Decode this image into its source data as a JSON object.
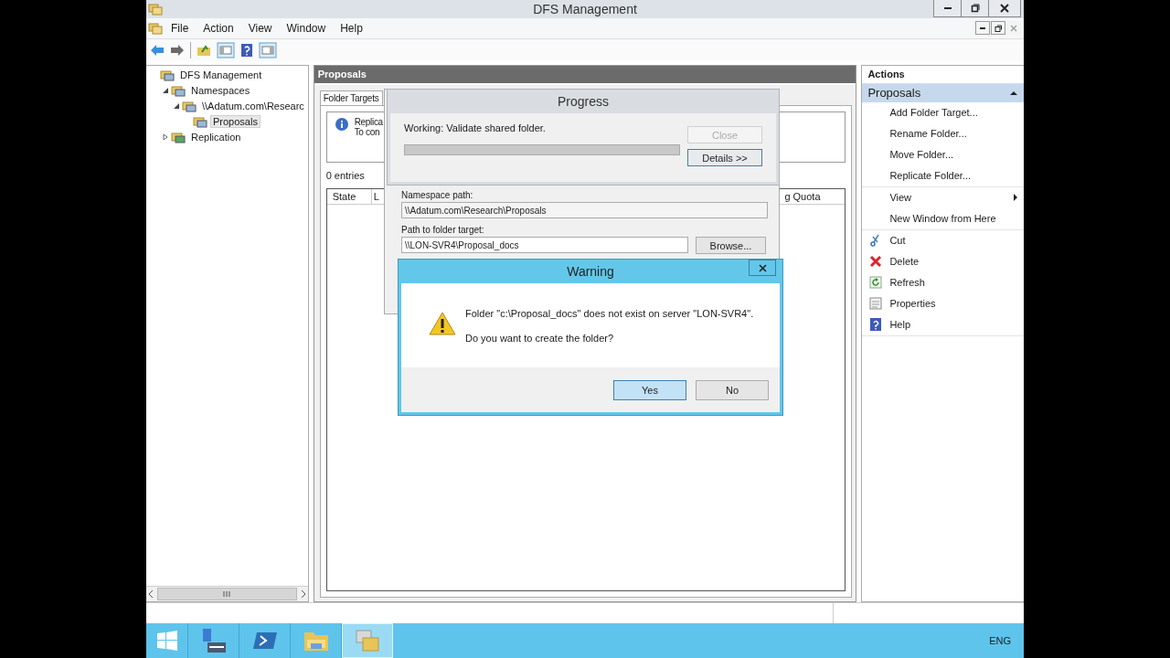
{
  "window": {
    "title": "DFS Management"
  },
  "menu": [
    "File",
    "Action",
    "View",
    "Window",
    "Help"
  ],
  "tree": [
    {
      "label": "DFS Management",
      "selected": false,
      "children": [
        {
          "label": "Namespaces",
          "selected": false,
          "expanded": true,
          "children": [
            {
              "label": "\\\\Adatum.com\\Researc",
              "selected": false,
              "expanded": true,
              "children": [
                {
                  "label": "Proposals",
                  "selected": true
                }
              ]
            }
          ]
        },
        {
          "label": "Replication",
          "selected": false,
          "expanded": false
        }
      ]
    }
  ],
  "center": {
    "title": "Proposals",
    "tabs": [
      {
        "label": "Folder Targets",
        "selected": true
      }
    ],
    "info": [
      "Replica",
      "To con"
    ],
    "entries": "0 entries",
    "columns": [
      "State",
      "L",
      "g Quota"
    ]
  },
  "actions": {
    "title": "Actions",
    "section": {
      "label": "Proposals",
      "expanded": true
    },
    "groups": [
      [
        {
          "label": "Add Folder Target...",
          "kind": "plain"
        },
        {
          "label": "Rename Folder...",
          "kind": "plain"
        },
        {
          "label": "Move Folder...",
          "kind": "plain"
        },
        {
          "label": "Replicate Folder...",
          "kind": "plain"
        }
      ],
      [
        {
          "label": "View",
          "kind": "submenu"
        },
        {
          "label": "New Window from Here",
          "kind": "plain"
        }
      ],
      [
        {
          "label": "Cut",
          "kind": "icon"
        },
        {
          "label": "Delete",
          "kind": "icon"
        },
        {
          "label": "Refresh",
          "kind": "icon"
        },
        {
          "label": "Properties",
          "kind": "icon"
        },
        {
          "label": "Help",
          "kind": "icon"
        }
      ]
    ]
  },
  "add_dialog": {
    "namespace_label": "Namespace path:",
    "namespace_value": "\\\\Adatum.com\\Research\\Proposals",
    "target_label": "Path to folder target:",
    "target_value": "\\\\LON-SVR4\\Proposal_docs",
    "browse": "Browse..."
  },
  "progress": {
    "title": "Progress",
    "status": "Working: Validate shared folder.",
    "level": 1,
    "buttons": [
      {
        "label": "Close",
        "disabled": true
      },
      {
        "label": "Details >>",
        "disabled": false
      }
    ]
  },
  "warning": {
    "title": "Warning",
    "message": "Folder \"c:\\Proposal_docs\" does not exist on server \"LON-SVR4\".",
    "question": "Do you want to create the folder?",
    "buttons": [
      {
        "label": "Yes",
        "focused": true
      },
      {
        "label": "No",
        "focused": false
      }
    ]
  },
  "taskbar": {
    "apps": [
      {
        "selected": false
      },
      {
        "selected": false
      },
      {
        "selected": false
      },
      {
        "selected": true
      }
    ],
    "language": "ENG"
  }
}
